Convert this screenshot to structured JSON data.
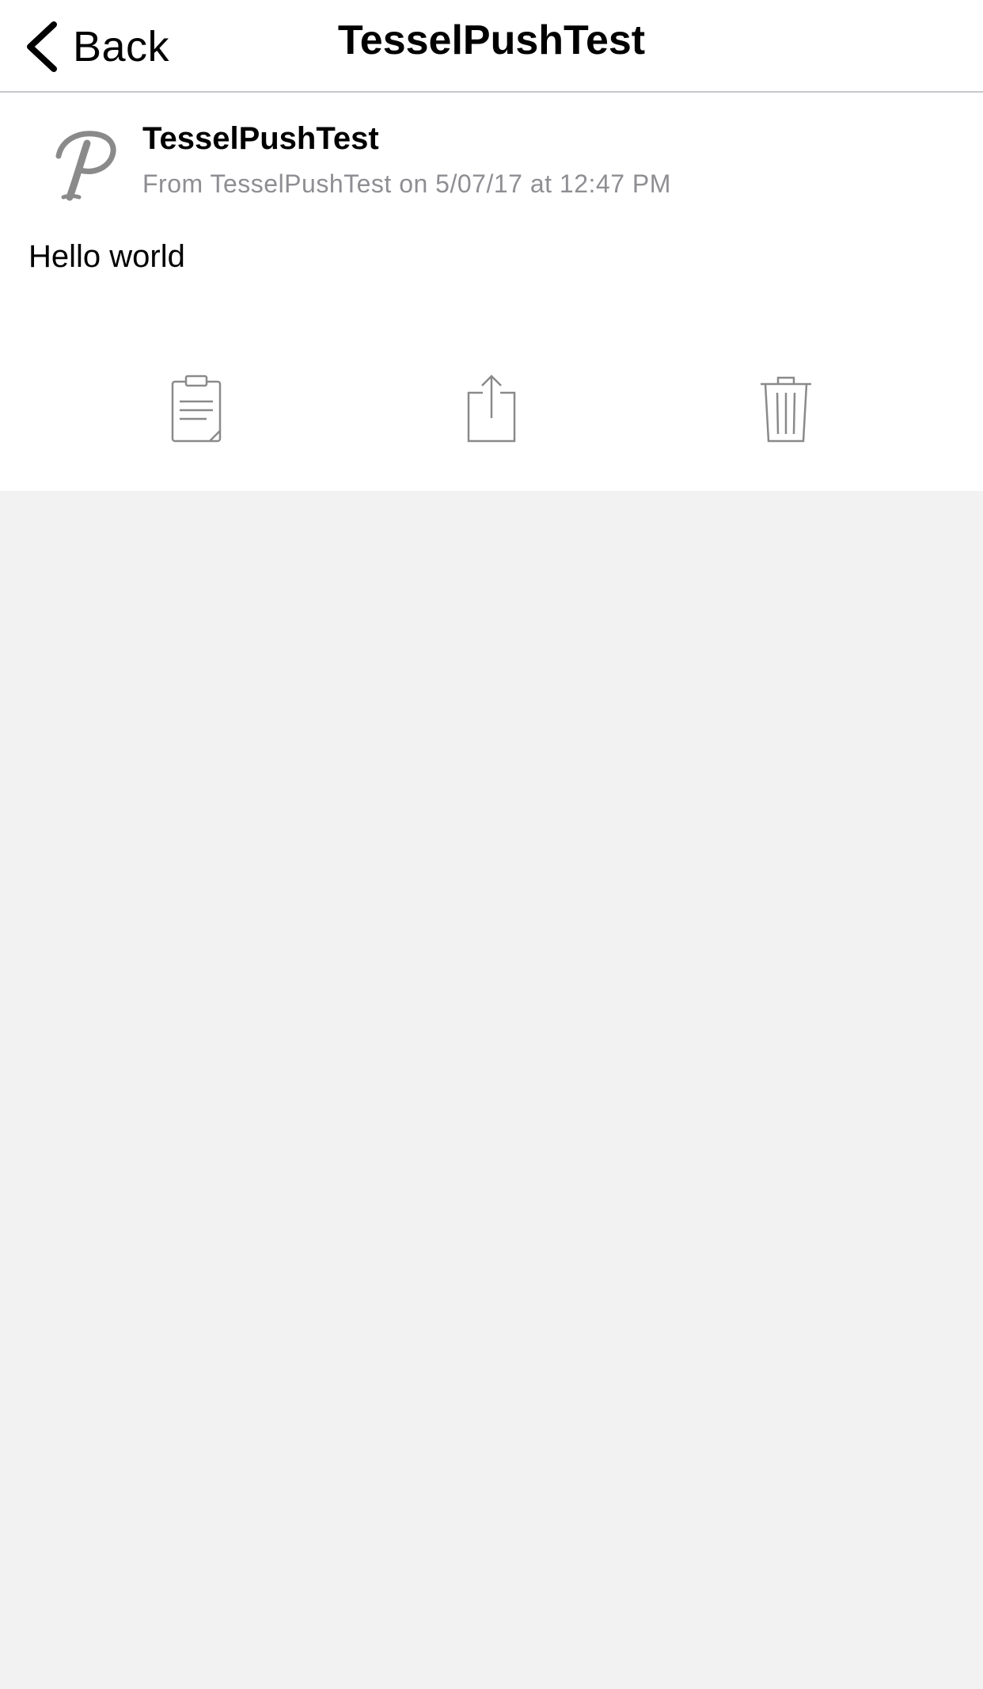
{
  "navbar": {
    "back_label": "Back",
    "title": "TesselPushTest"
  },
  "message": {
    "app_icon": "script-p-logo-icon",
    "sender": "TesselPushTest",
    "meta": "From TesselPushTest on 5/07/17 at 12:47 PM",
    "body": "Hello world"
  },
  "actions": [
    {
      "id": "copy",
      "icon": "clipboard-icon"
    },
    {
      "id": "share",
      "icon": "share-icon"
    },
    {
      "id": "delete",
      "icon": "trash-icon"
    }
  ],
  "colors": {
    "background": "#f2f2f2",
    "surface": "#ffffff",
    "text": "#000000",
    "secondary_text": "#8e8e93",
    "icon_gray": "#8a8a8a",
    "divider": "#c8c8cc"
  }
}
